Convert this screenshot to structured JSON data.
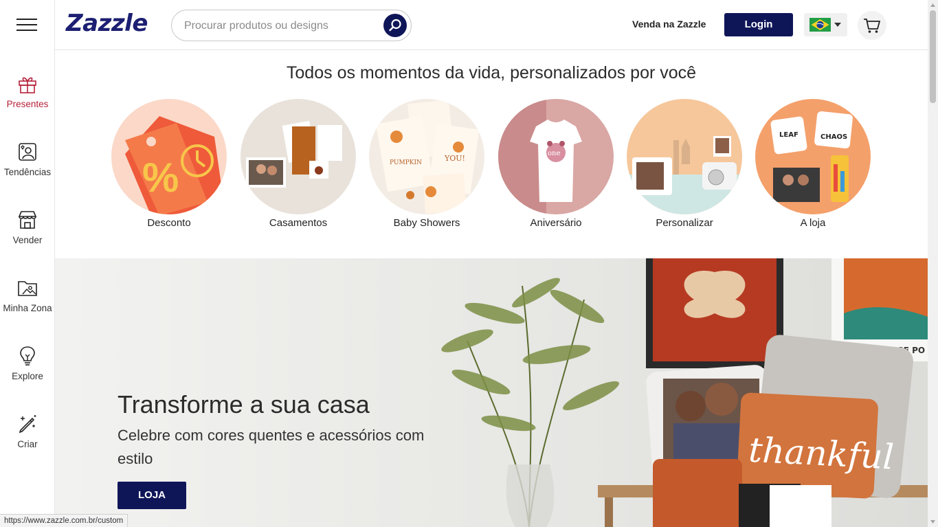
{
  "header": {
    "logo": "Zazzle",
    "search_placeholder": "Procurar produtos ou designs",
    "sell_link": "Venda na Zazzle",
    "login_label": "Login"
  },
  "sidebar": {
    "items": [
      {
        "label": "Presentes",
        "icon": "gift-icon"
      },
      {
        "label": "Tendências",
        "icon": "trending-profile-icon"
      },
      {
        "label": "Vender",
        "icon": "store-icon"
      },
      {
        "label": "Minha Zona",
        "icon": "folder-image-icon"
      },
      {
        "label": "Explore",
        "icon": "lightbulb-icon"
      },
      {
        "label": "Criar",
        "icon": "magic-pen-icon"
      }
    ]
  },
  "categories": {
    "title": "Todos os momentos da vida, personalizados por você",
    "items": [
      {
        "label": "Desconto"
      },
      {
        "label": "Casamentos"
      },
      {
        "label": "Baby Showers"
      },
      {
        "label": "Aniversário"
      },
      {
        "label": "Personalizar"
      },
      {
        "label": "A loja"
      }
    ]
  },
  "hero": {
    "title": "Transforme a sua casa",
    "subtitle": "Celebre com cores quentes e acessórios com estilo",
    "button": "LOJA"
  },
  "status_url": "https://www.zazzle.com.br/custom",
  "colors": {
    "brand_navy": "#0f1658",
    "logo_blue": "#1c1f72",
    "active_red": "#b5213a"
  }
}
